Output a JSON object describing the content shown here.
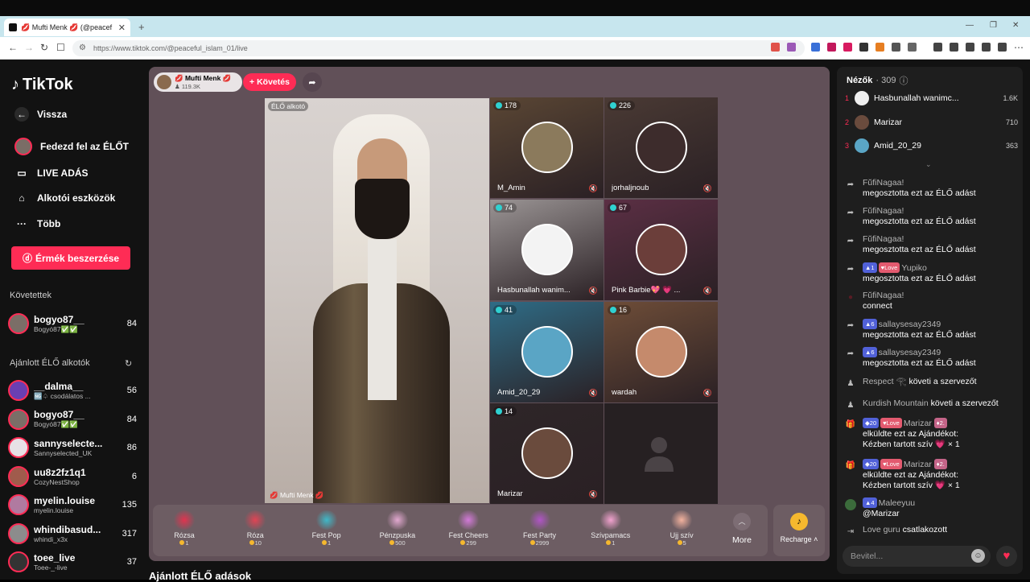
{
  "browser": {
    "tab_title": "💋 Mufti Menk 💋 (@peacef",
    "url": "https://www.tiktok.com/@peaceful_islam_01/live"
  },
  "sidebar": {
    "logo": "TikTok",
    "nav": [
      {
        "label": "Vissza",
        "icon": "back-arrow-icon"
      },
      {
        "label": "Fedezd fel az ÉLŐT",
        "icon": "explore-live-icon"
      },
      {
        "label": "LIVE ADÁS",
        "icon": "camera-icon"
      },
      {
        "label": "Alkotói eszközök",
        "icon": "home-icon"
      },
      {
        "label": "Több",
        "icon": "more-icon"
      }
    ],
    "coins_button": "Érmék beszerzése",
    "following_header": "Követettek",
    "following": [
      {
        "name": "bogyo87__",
        "sub": "Bogyó87✅✅",
        "count": "84",
        "color": "#7b6e67"
      }
    ],
    "suggested_header": "Ajánlott ÉLŐ alkotók",
    "suggested": [
      {
        "name": "__dalma__",
        "sub": "🆖♤ csodálatos ...",
        "count": "56",
        "color": "#6a3fb3"
      },
      {
        "name": "bogyo87__",
        "sub": "Bogyó87✅✅",
        "count": "84",
        "color": "#7b6e67"
      },
      {
        "name": "sannyselecte...",
        "sub": "Sannyselected_UK",
        "count": "86",
        "color": "#e7e1e6"
      },
      {
        "name": "uu8z2fz1q1",
        "sub": "CozyNestShop",
        "count": "6",
        "color": "#a05b4c"
      },
      {
        "name": "myelin.louise",
        "sub": "myelin.louise",
        "count": "135",
        "color": "#b07aa0"
      },
      {
        "name": "whindibasud...",
        "sub": "whindi_x3x",
        "count": "317",
        "color": "#8c8c8c"
      },
      {
        "name": "toee_live",
        "sub": "Toee-_-live",
        "count": "37",
        "color": "#333"
      }
    ]
  },
  "host": {
    "name": "💋 Mufti Menk 💋",
    "followers": "119.3K",
    "follow_button": "+ Követés",
    "video_label": "ÉLŐ alkotó",
    "video_name": "💋 Mufti Menk 💋"
  },
  "guests": [
    {
      "viewers": "178",
      "name": "M_Amin",
      "bg": "#5a4634",
      "av": "#8b7a5c"
    },
    {
      "viewers": "226",
      "name": "jorhaljnoub",
      "bg": "#4a3a34",
      "av": "#3d2c2c"
    },
    {
      "viewers": "74",
      "name": "Hasbunallah wanim...",
      "bg": "#9a9494",
      "av": "#f3f3f3"
    },
    {
      "viewers": "67",
      "name": "Pink Barbie💖 💗 ...",
      "bg": "#5b2f44",
      "av": "#6b3e3a"
    },
    {
      "viewers": "41",
      "name": "Amid_20_29",
      "bg": "#2f6c86",
      "av": "#5aa5c5"
    },
    {
      "viewers": "16",
      "name": "wardah",
      "bg": "#6e4d38",
      "av": "#c58a6c"
    },
    {
      "viewers": "14",
      "name": "Marizar",
      "bg": "#2e2628",
      "av": "#6a4b3d"
    }
  ],
  "gifts": [
    {
      "name": "Rózsa",
      "price": "1",
      "color": "#e0344f"
    },
    {
      "name": "Róza",
      "price": "10",
      "color": "#e04454"
    },
    {
      "name": "Fest Pop",
      "price": "1",
      "color": "#3fb8c8"
    },
    {
      "name": "Pénzpuska",
      "price": "500",
      "color": "#e2a8d0"
    },
    {
      "name": "Fest Cheers",
      "price": "299",
      "color": "#d27ad8"
    },
    {
      "name": "Fest Party",
      "price": "2999",
      "color": "#b055c6"
    },
    {
      "name": "Szívpamacs",
      "price": "1",
      "color": "#f2a2cf"
    },
    {
      "name": "Ujj szív",
      "price": "5",
      "color": "#f3b29e"
    }
  ],
  "more_label": "More",
  "recharge_label": "Recharge",
  "bottom_title": "Ajánlott ÉLŐ adások",
  "chat": {
    "viewers_label": "Nézők",
    "viewers_count": "· 309",
    "ranking": [
      {
        "rank": "1",
        "name": "Hasbunallah wanimc...",
        "value": "1.6K",
        "color": "#eee"
      },
      {
        "rank": "2",
        "name": "Marizar",
        "value": "710",
        "color": "#6a4b3d"
      },
      {
        "rank": "3",
        "name": "Amid_20_29",
        "value": "363",
        "color": "#5aa5c5"
      }
    ],
    "messages": [
      {
        "user": "FŭfiNagaa!",
        "text": "megosztotta ezt az ÉLŐ adást",
        "icon": "share-icon",
        "level": "",
        "love": false
      },
      {
        "user": "FŭfiNagaa!",
        "text": "megosztotta ezt az ÉLŐ adást",
        "icon": "share-icon",
        "level": "",
        "love": false
      },
      {
        "user": "FŭfiNagaa!",
        "text": "megosztotta ezt az ÉLŐ adást",
        "icon": "share-icon",
        "level": "",
        "love": false
      },
      {
        "user": "Yupiko",
        "text": "megosztotta ezt az ÉLŐ adást",
        "icon": "share-icon",
        "level": "1",
        "love": true
      },
      {
        "user": "FŭfiNagaa!",
        "text": "connect",
        "icon": "avatar-icon",
        "level": "",
        "love": false
      },
      {
        "user": "sallaysesay2349",
        "text": "megosztotta ezt az ÉLŐ adást",
        "icon": "share-icon",
        "level": "6",
        "love": false
      },
      {
        "user": "sallaysesay2349",
        "text": "megosztotta ezt az ÉLŐ adást",
        "icon": "share-icon",
        "level": "6",
        "love": false
      }
    ],
    "follows": [
      {
        "user": "Respect 𓂀",
        "text": "követi a szervezőt"
      },
      {
        "user": "Kurdish Mountain",
        "text": "követi a szervezőt"
      }
    ],
    "gifts": [
      {
        "user": "Marizar",
        "level": "20",
        "fan": "2.",
        "text1": "elküldte ezt az Ajándékot:",
        "text2": "Kézben tartott szív 💗 × 1"
      },
      {
        "user": "Marizar",
        "level": "20",
        "fan": "2.",
        "text1": "elküldte ezt az Ajándékot:",
        "text2": "Kézben tartott szív 💗 × 1"
      }
    ],
    "reply": {
      "user": "Maleeyuu",
      "level": "4",
      "text": "@Marizar"
    },
    "join": {
      "user": "Love guru",
      "text": "csatlakozott"
    },
    "input_placeholder": "Bevitel..."
  }
}
